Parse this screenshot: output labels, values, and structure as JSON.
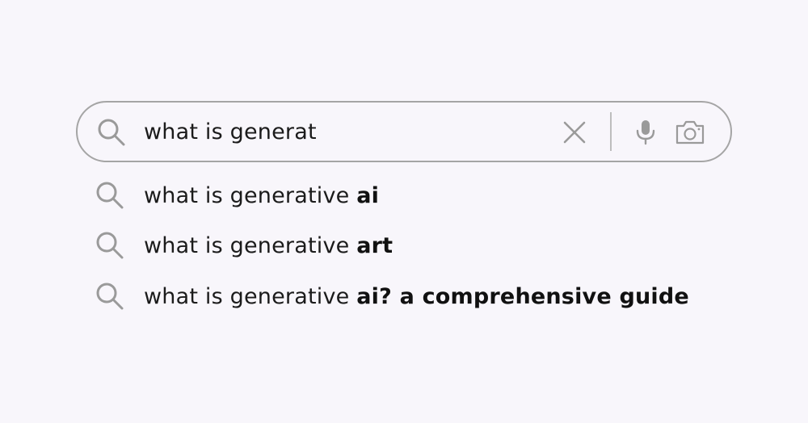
{
  "search": {
    "query": "what is generat",
    "icons": {
      "search": "search-icon",
      "clear": "close-icon",
      "voice": "microphone-icon",
      "image": "camera-icon"
    }
  },
  "suggestions": [
    {
      "prefix": "what is generative ",
      "completion": "ai"
    },
    {
      "prefix": "what is generative ",
      "completion": "art"
    },
    {
      "prefix": "what is generative ",
      "completion": "ai? a comprehensive guide"
    }
  ],
  "colors": {
    "background": "#f8f6fb",
    "border": "#a5a5a5",
    "icon": "#9a9a9a",
    "text": "#1b1b1b"
  }
}
